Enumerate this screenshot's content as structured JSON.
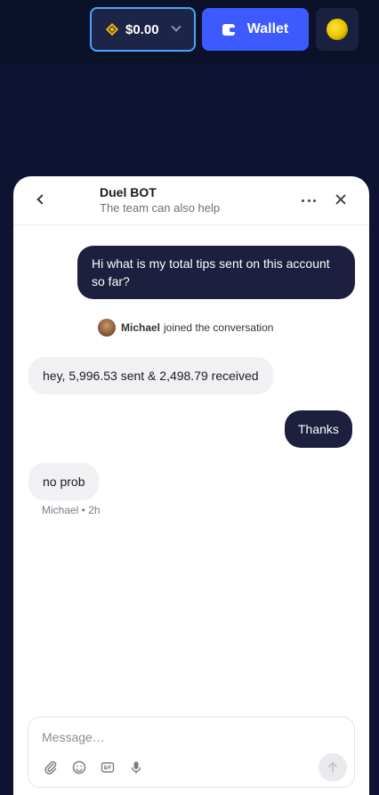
{
  "topbar": {
    "balance": "$0.00",
    "wallet_label": "Wallet",
    "colors": {
      "wallet_bg": "#3d5afe",
      "balance_border": "#4aa3ff",
      "coin": "#f0b90b"
    }
  },
  "chat": {
    "title": "Duel BOT",
    "subtitle": "The team can also help",
    "messages": [
      {
        "from": "user",
        "text": "Hi what is my total tips sent on this account so far?"
      },
      {
        "from": "agent",
        "text": "hey, 5,996.53 sent & 2,498.79 received"
      },
      {
        "from": "user",
        "text": "Thanks"
      },
      {
        "from": "agent",
        "text": "no prob"
      }
    ],
    "join_event": {
      "name": "Michael",
      "text": "joined the conversation"
    },
    "last_meta": "Michael • 2h"
  },
  "composer": {
    "placeholder": "Message…",
    "icons": [
      "attach-icon",
      "emoji-icon",
      "gif-icon",
      "mic-icon",
      "send-arrow-icon"
    ]
  }
}
